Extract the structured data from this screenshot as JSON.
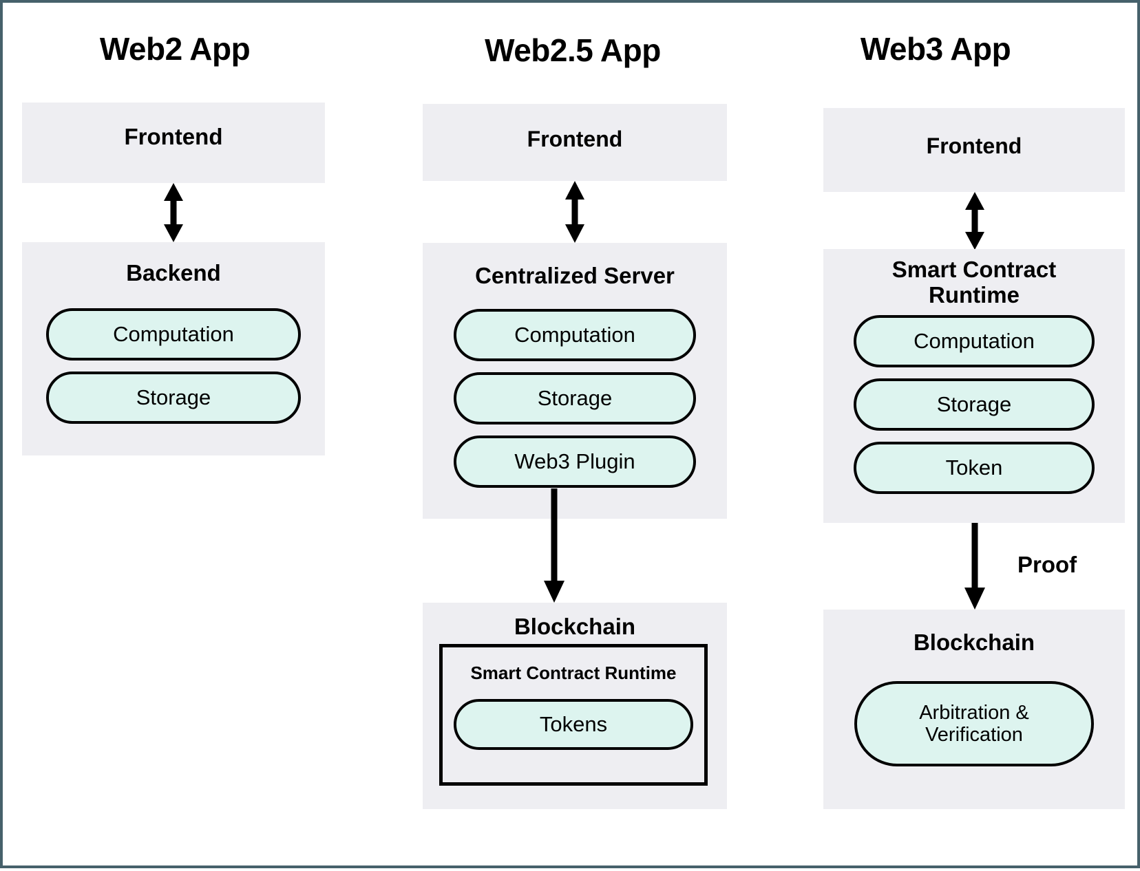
{
  "diagram": {
    "title_hidden": "",
    "colors": {
      "panel_bg": "#eeeef2",
      "pill_bg": "#ddf4ef",
      "stroke": "#000000",
      "frame": "#46616b",
      "page_bg": "#ffffff"
    }
  },
  "columns": [
    {
      "id": "web2",
      "title": "Web2 App",
      "panels": [
        {
          "id": "web2-frontend",
          "title": "Frontend",
          "pills": []
        },
        {
          "id": "web2-backend",
          "title": "Backend",
          "pills": [
            {
              "label": "Computation"
            },
            {
              "label": "Storage"
            }
          ]
        }
      ],
      "connectors": [
        {
          "id": "web2-frontend-backend",
          "type": "double",
          "label": ""
        }
      ]
    },
    {
      "id": "web25",
      "title": "Web2.5 App",
      "panels": [
        {
          "id": "web25-frontend",
          "title": "Frontend",
          "pills": []
        },
        {
          "id": "web25-server",
          "title": "Centralized Server",
          "pills": [
            {
              "label": "Computation"
            },
            {
              "label": "Storage"
            },
            {
              "label": "Web3 Plugin"
            }
          ]
        },
        {
          "id": "web25-blockchain",
          "title": "Blockchain",
          "inner_box": {
            "title": "Smart Contract Runtime",
            "pills": [
              {
                "label": "Tokens"
              }
            ]
          }
        }
      ],
      "connectors": [
        {
          "id": "web25-frontend-server",
          "type": "double",
          "label": ""
        },
        {
          "id": "web25-server-blockchain",
          "type": "down",
          "label": ""
        }
      ]
    },
    {
      "id": "web3",
      "title": "Web3 App",
      "panels": [
        {
          "id": "web3-frontend",
          "title": "Frontend",
          "pills": []
        },
        {
          "id": "web3-runtime",
          "title": "Smart Contract Runtime",
          "pills": [
            {
              "label": "Computation"
            },
            {
              "label": "Storage"
            },
            {
              "label": "Token"
            }
          ]
        },
        {
          "id": "web3-blockchain",
          "title": "Blockchain",
          "pills": [
            {
              "label": "Arbitration & Verification"
            }
          ]
        }
      ],
      "connectors": [
        {
          "id": "web3-frontend-runtime",
          "type": "double",
          "label": ""
        },
        {
          "id": "web3-runtime-blockchain",
          "type": "down",
          "label": "Proof"
        }
      ]
    }
  ]
}
